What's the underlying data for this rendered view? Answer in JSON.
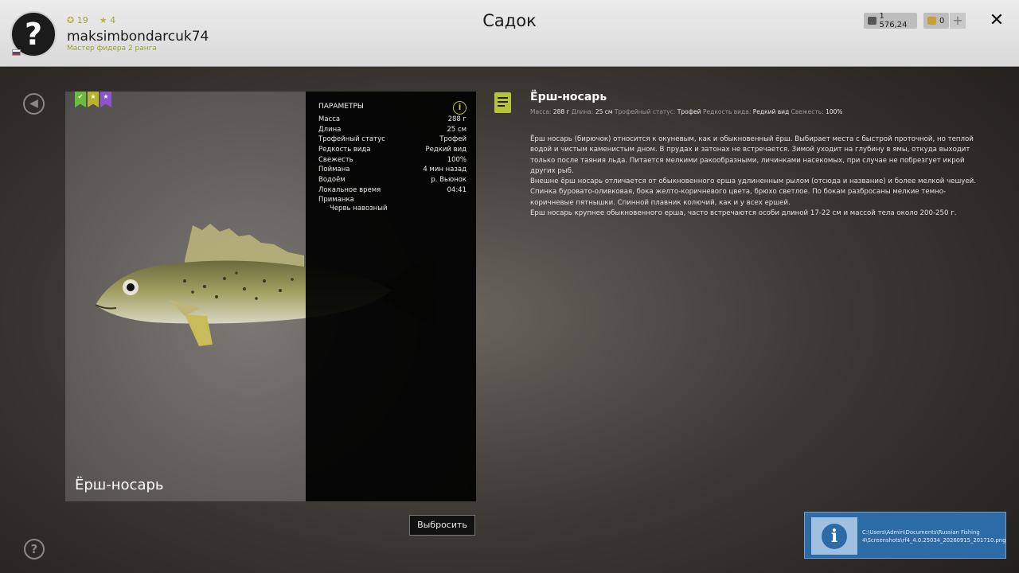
{
  "header": {
    "title": "Садок",
    "user": {
      "avatar_glyph": "?",
      "stat_level": "19",
      "stat_stars": "4",
      "username": "maksimbondarcuk74",
      "rank": "Мастер фидера 2 ранга"
    },
    "currency": {
      "silver": "1 576,24",
      "gold": "0",
      "add_label": "+"
    },
    "close_label": "✕"
  },
  "nav": {
    "back_icon": "back-arrow-icon",
    "help_glyph": "?"
  },
  "card": {
    "fish_name": "Ёрш-носарь",
    "badges": [
      {
        "icon": "check-badge",
        "color": "#6dbb3a",
        "glyph": "✔"
      },
      {
        "icon": "star-badge",
        "color": "#b7b42c",
        "glyph": "★"
      },
      {
        "icon": "star-badge",
        "color": "#8c54c8",
        "glyph": "★"
      }
    ],
    "params": {
      "title": "ПАРАМЕТРЫ",
      "rows": [
        {
          "label": "Масса",
          "value": "288 г"
        },
        {
          "label": "Длина",
          "value": "25 см"
        },
        {
          "label": "Трофейный статус",
          "value": "Трофей"
        },
        {
          "label": "Редкость вида",
          "value": "Редкий вид"
        },
        {
          "label": "Свежесть",
          "value": "100%"
        },
        {
          "label": "Поймана",
          "value": "4 мин назад"
        },
        {
          "label": "Водоём",
          "value": "р. Вьюнок"
        },
        {
          "label": "Локальное время",
          "value": "04:41"
        }
      ],
      "bait_label": "Приманка",
      "bait_value": "Червь навозный"
    }
  },
  "discard_button": "Выбросить",
  "description": {
    "title": "Ёрш-носарь",
    "meta": {
      "mass_label": "Масса:",
      "mass": "288 г",
      "length_label": "Длина:",
      "length": "25 см",
      "trophy_label": "Трофейный статус:",
      "trophy": "Трофей",
      "rarity_label": "Редкость вида:",
      "rarity": "Редкий вид",
      "freshness_label": "Свежесть:",
      "freshness": "100%"
    },
    "paragraphs": [
      "Ёрш носарь (бирючок) относится к окуневым, как и обыкновенный ёрш. Выбирает места с быстрой проточной, но теплой водой и чистым каменистым дном. В прудах и затонах не встречается. Зимой уходит на глубину в ямы, откуда выходит только после таяния льда. Питается мелкими ракообразными, личинками насекомых, при случае не побрезгует икрой других рыб.",
      "Внешне ёрш носарь отличается от обыкновенного ерша удлиненным рылом (отсюда и название) и более мелкой чешуей. Спинка буровато-оливковая, бока желто-коричневого цвета, брюхо светлое. По бокам разбросаны мелкие темно-коричневые пятнышки. Спинной плавник колючий, как и у всех ершей.",
      "Ерш носарь крупнее обыкновенного ерша, часто встречаются особи длиной 17-22 см и массой тела около 200-250 г."
    ]
  },
  "notification": {
    "icon": "info-icon",
    "text": "C:\\Users\\Admin\\Documents\\Russian Fishing 4\\Screenshots\\rf4_4.0.25034_20260915_201710.png"
  }
}
